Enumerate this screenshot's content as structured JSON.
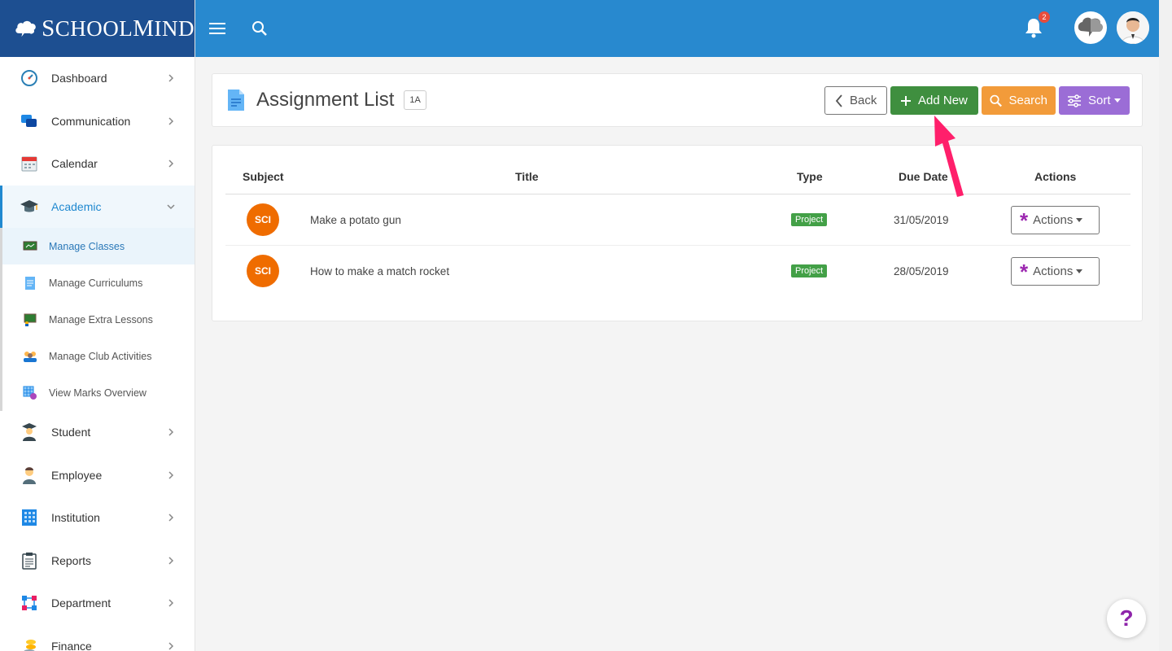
{
  "brand": {
    "name_cap1": "S",
    "name_rest1": "CHOOL",
    "name_cap2": "M",
    "name_rest2": "IND"
  },
  "sidebar": {
    "items": [
      {
        "label": "Dashboard"
      },
      {
        "label": "Communication"
      },
      {
        "label": "Calendar"
      },
      {
        "label": "Academic"
      },
      {
        "label": "Student"
      },
      {
        "label": "Employee"
      },
      {
        "label": "Institution"
      },
      {
        "label": "Reports"
      },
      {
        "label": "Department"
      },
      {
        "label": "Finance"
      }
    ],
    "academic_sub": [
      {
        "label": "Manage Classes"
      },
      {
        "label": "Manage Curriculums"
      },
      {
        "label": "Manage Extra Lessons"
      },
      {
        "label": "Manage Club Activities"
      },
      {
        "label": "View Marks Overview"
      }
    ]
  },
  "topbar": {
    "notification_count": "2"
  },
  "header": {
    "title": "Assignment List",
    "class_badge": "1A",
    "back_label": "Back",
    "add_label": "Add New",
    "search_label": "Search",
    "sort_label": "Sort"
  },
  "table": {
    "headers": {
      "subject": "Subject",
      "title": "Title",
      "type": "Type",
      "due": "Due Date",
      "actions": "Actions"
    },
    "rows": [
      {
        "subject": "SCI",
        "title": "Make a potato gun",
        "type": "Project",
        "due": "31/05/2019",
        "actions": "Actions"
      },
      {
        "subject": "SCI",
        "title": "How to make a match rocket",
        "type": "Project",
        "due": "28/05/2019",
        "actions": "Actions"
      }
    ]
  },
  "help": {
    "label": "?"
  },
  "colors": {
    "topbar": "#2889cf",
    "logo_bg": "#1d4f91",
    "add": "#3f8f3f",
    "search": "#f29b3a",
    "sort": "#9b6dd6",
    "subject": "#ef6c00",
    "project": "#43a047",
    "annotation_arrow": "#ff1f6b"
  }
}
